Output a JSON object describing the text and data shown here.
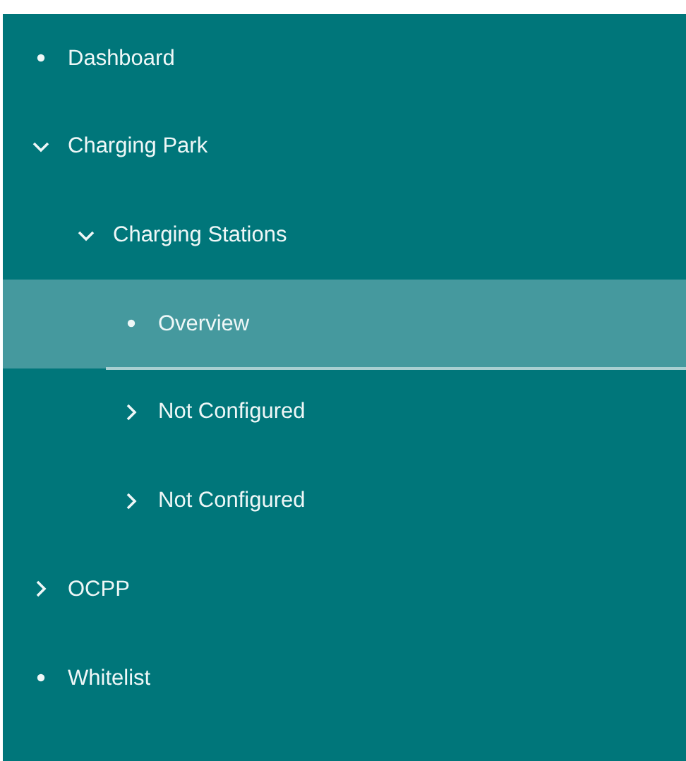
{
  "nav": {
    "items": [
      {
        "label": "Dashboard",
        "kind": "leaf",
        "selected": false
      },
      {
        "label": "Charging Park",
        "kind": "group",
        "expanded": true,
        "selected": false,
        "children": [
          {
            "label": "Charging Stations",
            "kind": "group",
            "expanded": true,
            "selected": false,
            "children": [
              {
                "label": "Overview",
                "kind": "leaf",
                "selected": true
              },
              {
                "label": "Not Configured",
                "kind": "group",
                "expanded": false,
                "selected": false
              },
              {
                "label": "Not Configured",
                "kind": "group",
                "expanded": false,
                "selected": false
              }
            ]
          }
        ]
      },
      {
        "label": "OCPP",
        "kind": "group",
        "expanded": false,
        "selected": false
      },
      {
        "label": "Whitelist",
        "kind": "leaf",
        "selected": false
      }
    ]
  }
}
